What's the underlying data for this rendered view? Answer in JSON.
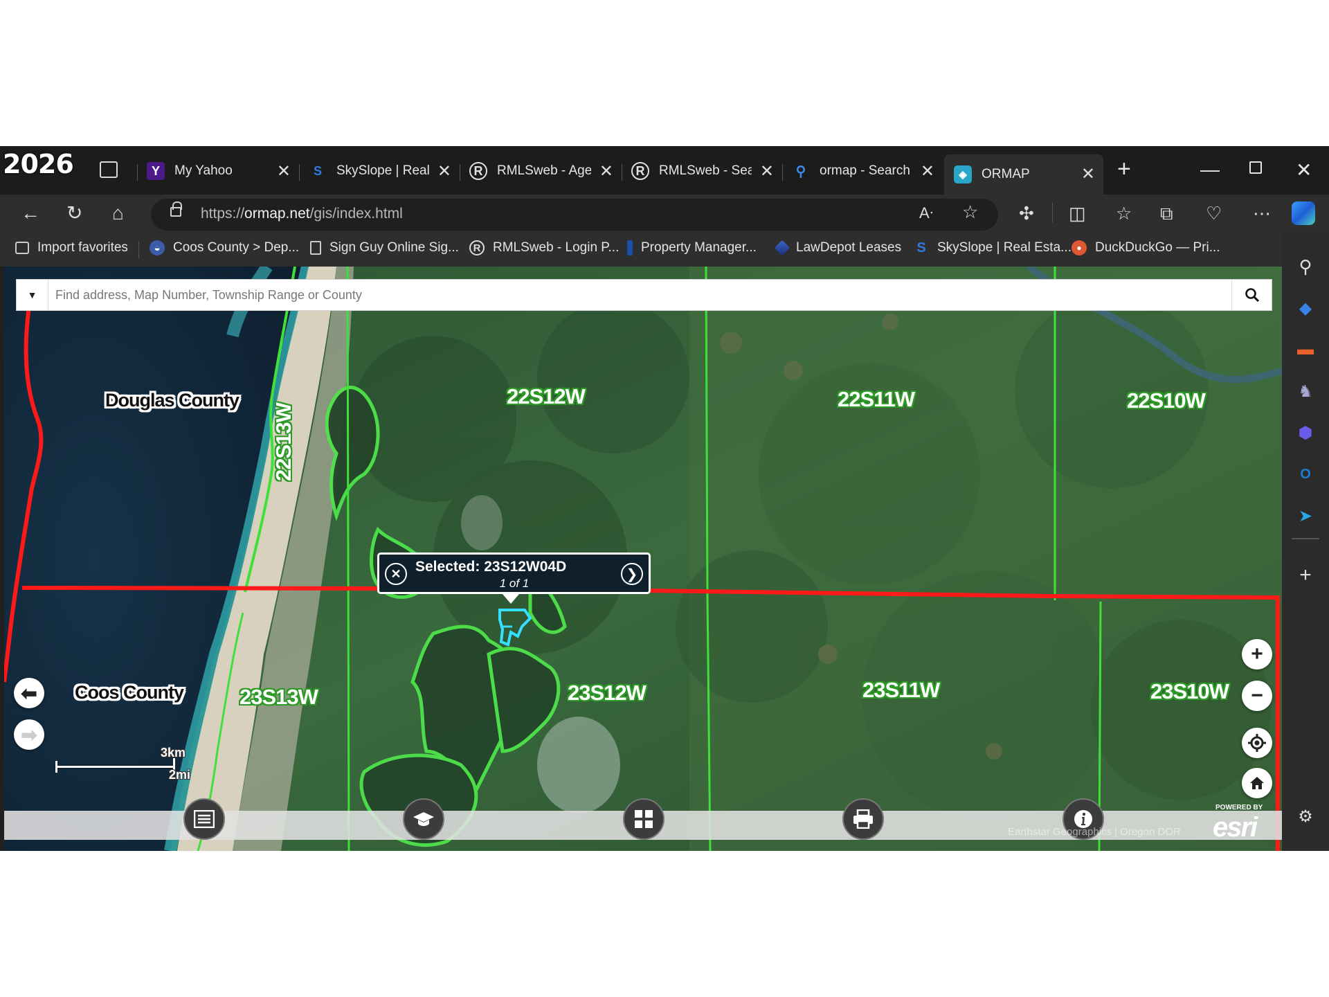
{
  "watermark": "2026",
  "tabs": [
    {
      "label": "My Yahoo",
      "icon": "yahoo-icon"
    },
    {
      "label": "SkySlope | Real E",
      "icon": "skyslope-icon"
    },
    {
      "label": "RMLSweb - Ager",
      "icon": "rmls-icon"
    },
    {
      "label": "RMLSweb - Searc",
      "icon": "rmls-icon"
    },
    {
      "label": "ormap - Search",
      "icon": "search-icon"
    },
    {
      "label": "ORMAP",
      "icon": "ormap-icon",
      "active": true
    }
  ],
  "address": {
    "prefix": "https://",
    "host": "ormap.net",
    "path": "/gis/index.html"
  },
  "bookmarks": [
    {
      "label": "Import favorites",
      "icon": "import-icon"
    },
    {
      "label": "Coos County > Dep...",
      "icon": "county-icon"
    },
    {
      "label": "Sign Guy Online Sig...",
      "icon": "page-icon"
    },
    {
      "label": "RMLSweb - Login P...",
      "icon": "rmls-icon"
    },
    {
      "label": "Property Manager...",
      "icon": "bookmark-icon"
    },
    {
      "label": "LawDepot Leases",
      "icon": "lawdepot-icon"
    },
    {
      "label": "SkySlope | Real Esta...",
      "icon": "skyslope-icon"
    },
    {
      "label": "DuckDuckGo — Pri...",
      "icon": "duckduckgo-icon"
    }
  ],
  "map": {
    "search_placeholder": "Find address, Map Number, Township Range or County",
    "counties": [
      "Douglas County",
      "Coos County"
    ],
    "townships": {
      "t22s13w": "22S13W",
      "t22s12w": "22S12W",
      "t22s11w": "22S11W",
      "t22s10w": "22S10W",
      "t23s13w": "23S13W",
      "t23s12w": "23S12W",
      "t23s11w": "23S11W",
      "t23s10w": "23S10W"
    },
    "popup": {
      "title": "Selected: 23S12W04D",
      "count": "1 of 1"
    },
    "scale": {
      "km": "3km",
      "mi": "2mi"
    },
    "attribution": "Earthstar Geographics | Oregon DOR",
    "esri_powered": "POWERED BY",
    "esri_logo": "esri",
    "colors": {
      "county_line": "#ff1a1a",
      "township_line": "#33dd33",
      "selection": "#35e0ff"
    }
  }
}
